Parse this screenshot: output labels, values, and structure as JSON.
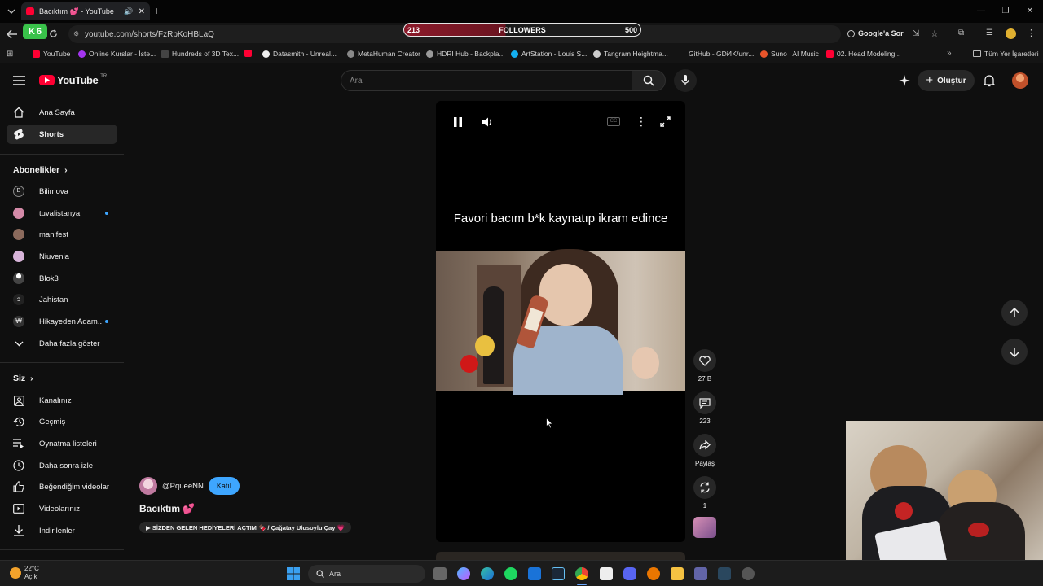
{
  "browser": {
    "tab_title": "Bacıktım 💕 - YouTube",
    "url": "youtube.com/shorts/FzRbKoHBLaQ",
    "ext_badge": "6",
    "followers": {
      "label": "FOLLOWERS",
      "current": "213",
      "goal": "500",
      "progress": 0.426
    },
    "google_lens": "Google'a Sor",
    "bookmarks": [
      "YouTube",
      "Online Kurslar - İste...",
      "Hundreds of 3D Tex...",
      "Datasmith - Unreal...",
      "MetaHuman Creator",
      "HDRI Hub - Backpla...",
      "ArtStation - Louis S...",
      "Tangram Heightma...",
      "GitHub - GDi4K/unr...",
      "Suno | AI Music",
      "02. Head Modeling..."
    ],
    "all_bookmarks": "Tüm Yer İşaretleri"
  },
  "youtube": {
    "logo": "YouTube",
    "logo_region": "TR",
    "search_placeholder": "Ara",
    "create_label": "Oluştur"
  },
  "sidebar": {
    "main": [
      {
        "label": "Ana Sayfa",
        "icon": "home-icon"
      },
      {
        "label": "Shorts",
        "icon": "shorts-icon"
      }
    ],
    "subs_header": "Abonelikler",
    "subs": [
      {
        "label": "Bilimova",
        "color": "#1a1a1a",
        "new": false
      },
      {
        "label": "tuvalistanya",
        "color": "#d48aa8",
        "new": true
      },
      {
        "label": "manifest",
        "color": "#8b6a5c",
        "new": false
      },
      {
        "label": "Niuvenia",
        "color": "#d7b4d9",
        "new": false
      },
      {
        "label": "Blok3",
        "color": "#444444",
        "new": false
      },
      {
        "label": "Jahistan",
        "color": "#222222",
        "new": false
      },
      {
        "label": "Hikayeden Adam...",
        "color": "#333333",
        "new": true
      }
    ],
    "show_more": "Daha fazla göster",
    "you_header": "Siz",
    "you": [
      {
        "label": "Kanalınız",
        "icon": "channel-icon"
      },
      {
        "label": "Geçmiş",
        "icon": "history-icon"
      },
      {
        "label": "Oynatma listeleri",
        "icon": "playlist-icon"
      },
      {
        "label": "Daha sonra izle",
        "icon": "clock-icon"
      },
      {
        "label": "Beğendiğim videolar",
        "icon": "like-icon"
      },
      {
        "label": "Videolarınız",
        "icon": "video-icon"
      },
      {
        "label": "İndirilenler",
        "icon": "download-icon"
      }
    ]
  },
  "short": {
    "overlay_text": "Favori bacım b*k kaynatıp ikram edince",
    "channel": "@PqueeNN",
    "join": "Katıl",
    "title": "Bacıktım 💕",
    "music": "▶ SİZDEN GELEN HEDİYELERİ AÇTIM 🍫 / Çağatay Ulusoylu Çay 💗",
    "actions": [
      {
        "name": "like",
        "label": "27 B"
      },
      {
        "name": "comment",
        "label": "223"
      },
      {
        "name": "share",
        "label": "Paylaş"
      },
      {
        "name": "remix",
        "label": "1"
      }
    ]
  },
  "taskbar": {
    "temp": "22°C",
    "condition": "Açık",
    "search": "Ara"
  }
}
